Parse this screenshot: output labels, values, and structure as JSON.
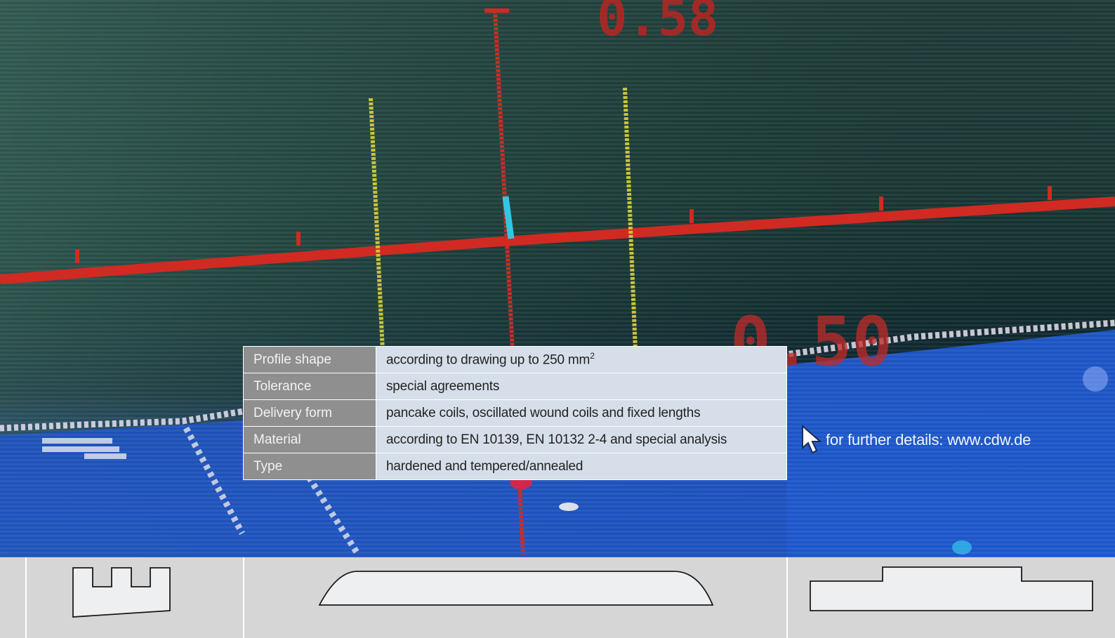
{
  "spec_table": {
    "rows": [
      {
        "label": "Profile shape",
        "value": "according to drawing up to 250 mm",
        "sup": "2"
      },
      {
        "label": "Tolerance",
        "value": "special agreements"
      },
      {
        "label": "Delivery form",
        "value": "pancake coils, oscillated wound coils and fixed lengths"
      },
      {
        "label": "Material",
        "value": "according to EN 10139, EN 10132 2-4 and special analysis"
      },
      {
        "label": "Type",
        "value": "hardened and tempered/annealed"
      }
    ]
  },
  "details": {
    "text": "for further details: www.cdw.de",
    "icon": "cursor-arrow-icon"
  },
  "background": {
    "screen_readouts": [
      "0.58",
      "0.50"
    ],
    "colors": {
      "red_line": "#d12a22",
      "yellow_line": "#c9c43a",
      "blue_zone": "#1d55c4"
    }
  },
  "profiles": [
    {
      "icon": "comb-profile-icon"
    },
    {
      "icon": "rounded-flat-profile-icon"
    },
    {
      "icon": "stepped-profile-icon"
    }
  ]
}
